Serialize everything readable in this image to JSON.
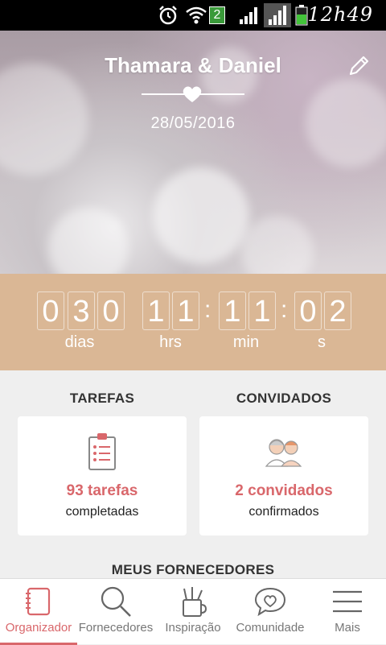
{
  "status_bar": {
    "time": "12h49",
    "notification_count": "2",
    "icons": [
      "alarm-icon",
      "wifi-icon",
      "signal-icon",
      "battery-icon"
    ]
  },
  "hero": {
    "couple_names": "Thamara & Daniel",
    "wedding_date": "28/05/2016",
    "icons": [
      "edit-icon",
      "heart-icon"
    ]
  },
  "countdown": {
    "days": [
      "0",
      "3",
      "0"
    ],
    "hours": [
      "1",
      "1"
    ],
    "minutes": [
      "1",
      "1"
    ],
    "seconds": [
      "0",
      "2"
    ],
    "separator": ":",
    "labels": {
      "days": "dias",
      "hours": "hrs",
      "minutes": "min",
      "seconds": "s"
    },
    "background_color": "#dab795"
  },
  "tasks": {
    "title": "TAREFAS",
    "count": "93 tarefas",
    "subtitle": "completadas",
    "icon": "clipboard-icon"
  },
  "guests": {
    "title": "CONVIDADOS",
    "count": "2 convidados",
    "subtitle": "confirmados",
    "icon": "guests-icon"
  },
  "vendors_title": "MEUS FORNECEDORES",
  "bottom_nav": {
    "items": [
      {
        "label": "Organizador",
        "icon": "notebook-icon",
        "active": true
      },
      {
        "label": "Fornecedores",
        "icon": "search-icon",
        "active": false
      },
      {
        "label": "Inspiração",
        "icon": "pencil-cup-icon",
        "active": false
      },
      {
        "label": "Comunidade",
        "icon": "chat-heart-icon",
        "active": false
      },
      {
        "label": "Mais",
        "icon": "menu-icon",
        "active": false
      }
    ]
  },
  "colors": {
    "accent": "#d9676b",
    "countdown_bg": "#dab795",
    "page_bg": "#efefef"
  }
}
